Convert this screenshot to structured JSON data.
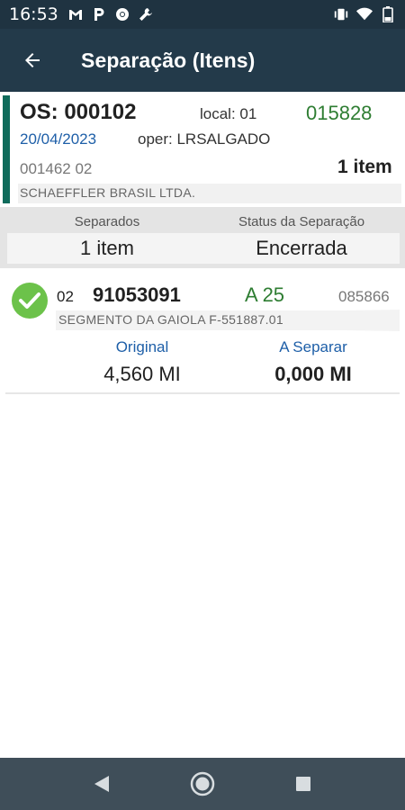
{
  "status_bar": {
    "time": "16:53",
    "left_icons": [
      "gmail-icon",
      "parking-icon",
      "chrome-icon",
      "wrench-icon"
    ],
    "right_icons": [
      "vibrate-icon",
      "wifi-icon",
      "battery-icon"
    ]
  },
  "app_bar": {
    "title": "Separação (Itens)",
    "back_icon": "arrow-left-icon"
  },
  "order": {
    "os_label": "OS: 000102",
    "local": "local: 01",
    "code": "015828",
    "date": "20/04/2023",
    "operator": "oper: LRSALGADO",
    "client_code": "001462 02",
    "item_count": "1 item",
    "client_name": "SCHAEFFLER BRASIL LTDA."
  },
  "summary": {
    "separados_header": "Separados",
    "separados_value": "1 item",
    "status_header": "Status da Separação",
    "status_value": "Encerrada"
  },
  "items": [
    {
      "status_icon": "check-circle-icon",
      "seq": "02",
      "product_code": "91053091",
      "location": "A 25",
      "ref": "085866",
      "description": "SEGMENTO DA GAIOLA F-551887.01",
      "original_label": "Original",
      "original_value": "4,560 MI",
      "to_separate_label": "A Separar",
      "to_separate_value": "0,000 MI"
    }
  ],
  "colors": {
    "status_bar": "#1f3341",
    "app_bar": "#233a4a",
    "accent": "#0f6b5b",
    "green_text": "#2e7d32",
    "blue_text": "#1e5fa8",
    "check_green": "#6cc24a",
    "nav_bar": "#3f4e59"
  },
  "nav": {
    "back": "triangle-back-icon",
    "home": "circle-home-icon",
    "recents": "square-recents-icon"
  }
}
